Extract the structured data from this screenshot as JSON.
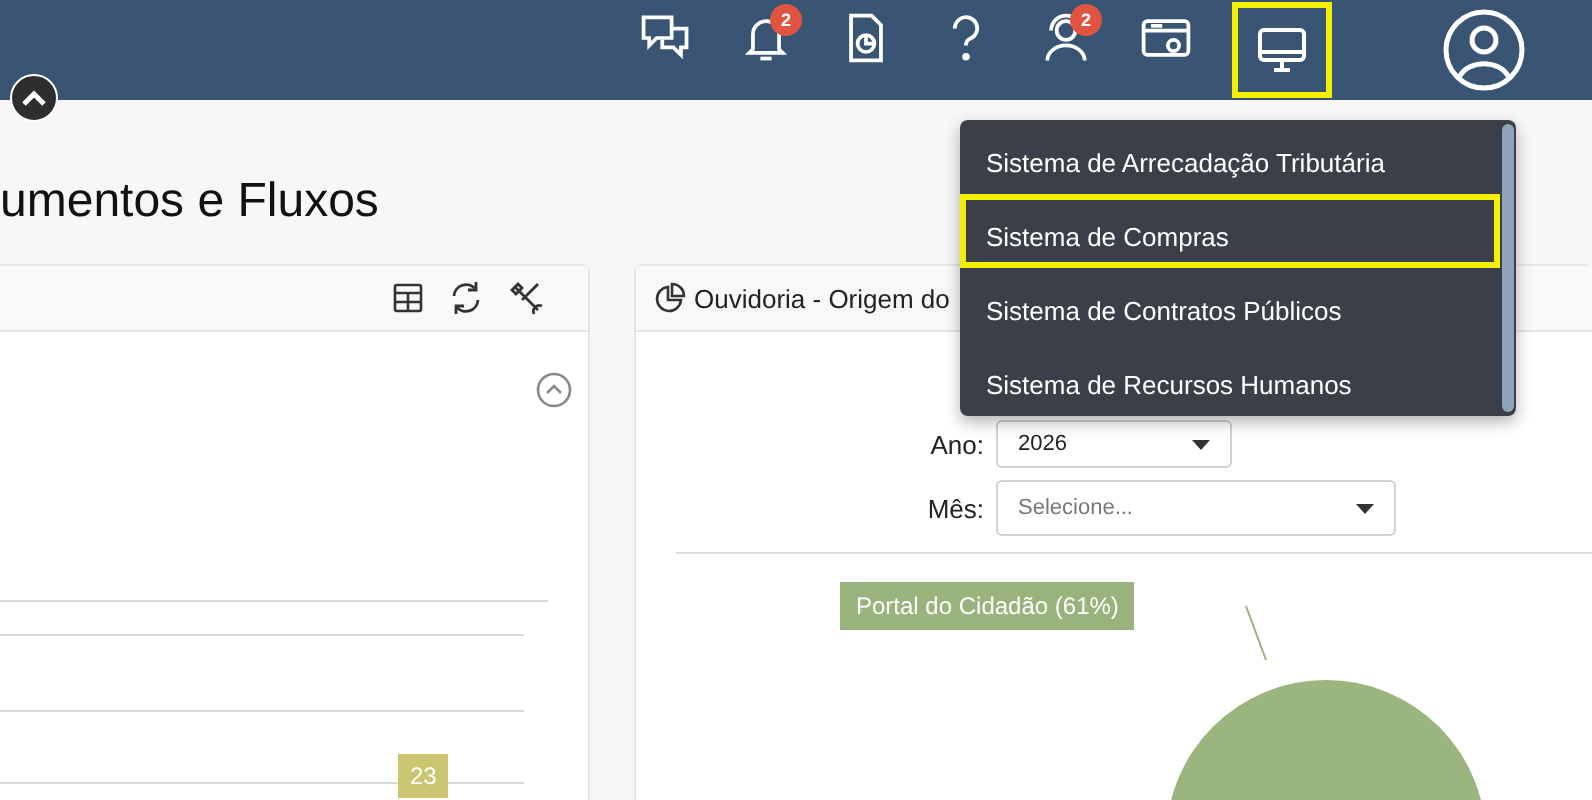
{
  "header": {
    "icons": [
      {
        "kind": "chat",
        "highlighted": false
      },
      {
        "kind": "bell",
        "badge": "2",
        "highlighted": false
      },
      {
        "kind": "report",
        "highlighted": false
      },
      {
        "kind": "help",
        "highlighted": false
      },
      {
        "kind": "support",
        "badge": "2",
        "highlighted": false
      },
      {
        "kind": "browser",
        "highlighted": false
      },
      {
        "kind": "monitor",
        "highlighted": true
      }
    ]
  },
  "page_title": "umentos e Fluxos",
  "left_card": {
    "bar_label": "23"
  },
  "right_card": {
    "title": "Ouvidoria - Origem do",
    "filters": [
      {
        "label": "Ano:",
        "value": "2026"
      },
      {
        "label": "Mês:",
        "placeholder": "Selecione..."
      }
    ],
    "pie_label": "Portal do Cidadão (61%)"
  },
  "dropdown": {
    "items": [
      {
        "label": "Sistema de Arrecadação Tributária",
        "selected": false
      },
      {
        "label": "Sistema de Compras",
        "selected": true
      },
      {
        "label": "Sistema de Contratos Públicos",
        "selected": false
      },
      {
        "label": "Sistema de Recursos Humanos",
        "selected": false
      }
    ]
  }
}
